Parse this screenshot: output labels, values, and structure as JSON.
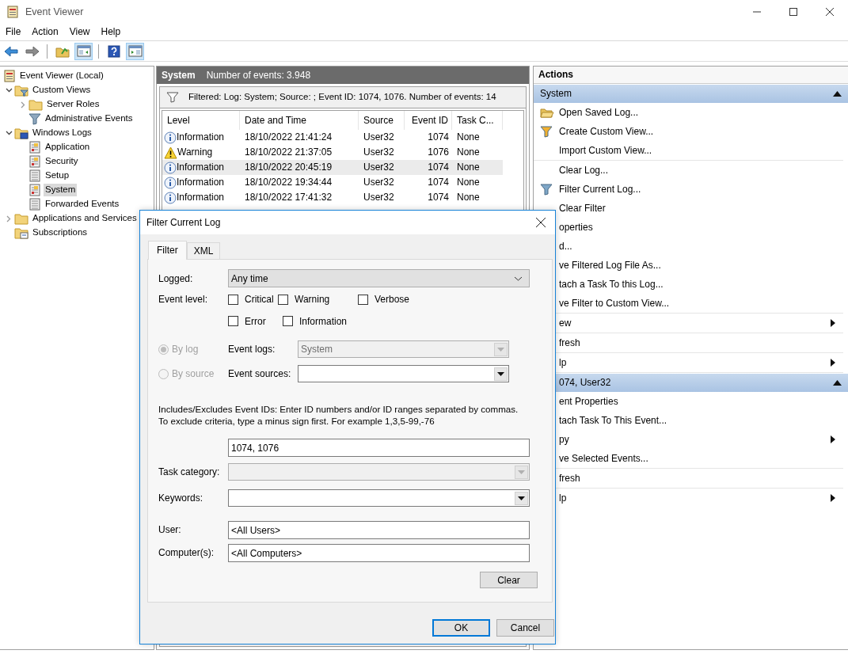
{
  "window": {
    "title": "Event Viewer"
  },
  "menu": [
    "File",
    "Action",
    "View",
    "Help"
  ],
  "toolbar": [
    {
      "kind": "back",
      "pressed": false
    },
    {
      "kind": "forward",
      "pressed": false
    },
    {
      "kind": "sep"
    },
    {
      "kind": "folder-up",
      "pressed": false
    },
    {
      "kind": "pane",
      "pressed": true
    },
    {
      "kind": "sep"
    },
    {
      "kind": "help",
      "pressed": false
    },
    {
      "kind": "pane-right",
      "pressed": true
    }
  ],
  "tree": [
    {
      "label": "Event Viewer (Local)",
      "kind": "root",
      "selected": false,
      "children": [
        {
          "label": "Custom Views",
          "kind": "folder-filter",
          "selected": false,
          "expanded": true,
          "children": [
            {
              "label": "Server Roles",
              "kind": "folder",
              "selected": false,
              "expanded": false
            },
            {
              "label": "Administrative Events",
              "kind": "filter",
              "selected": false
            }
          ]
        },
        {
          "label": "Windows Logs",
          "kind": "folder-logs",
          "selected": false,
          "expanded": true,
          "children": [
            {
              "label": "Application",
              "kind": "log",
              "selected": false
            },
            {
              "label": "Security",
              "kind": "log",
              "selected": false
            },
            {
              "label": "Setup",
              "kind": "log-plain",
              "selected": false
            },
            {
              "label": "System",
              "kind": "log",
              "selected": true
            },
            {
              "label": "Forwarded Events",
              "kind": "log-plain",
              "selected": false
            }
          ]
        },
        {
          "label": "Applications and Services",
          "kind": "folder",
          "selected": false,
          "expanded": false
        },
        {
          "label": "Subscriptions",
          "kind": "folder-sub",
          "selected": false
        }
      ]
    }
  ],
  "log_header": {
    "title": "System",
    "count": "Number of events: 3.948"
  },
  "filter_bar": "Filtered: Log: System; Source: ; Event ID: 1074, 1076. Number of events: 14",
  "table": {
    "columns": [
      "Level",
      "Date and Time",
      "Source",
      "Event ID",
      "Task C..."
    ],
    "rows": [
      {
        "kind": "information",
        "level": "Information",
        "date_time": "18/10/2022 21:41:24",
        "source": "User32",
        "event_id": "1074",
        "task_category": "None",
        "selected": false
      },
      {
        "kind": "warning",
        "level": "Warning",
        "date_time": "18/10/2022 21:37:05",
        "source": "User32",
        "event_id": "1076",
        "task_category": "None",
        "selected": false
      },
      {
        "kind": "information",
        "level": "Information",
        "date_time": "18/10/2022 20:45:19",
        "source": "User32",
        "event_id": "1074",
        "task_category": "None",
        "selected": true
      },
      {
        "kind": "information",
        "level": "Information",
        "date_time": "18/10/2022 19:34:44",
        "source": "User32",
        "event_id": "1074",
        "task_category": "None",
        "selected": false
      },
      {
        "kind": "information",
        "level": "Information",
        "date_time": "18/10/2022 17:41:32",
        "source": "User32",
        "event_id": "1074",
        "task_category": "None",
        "selected": false
      }
    ]
  },
  "actions": {
    "title": "Actions",
    "sections": [
      {
        "title": "System",
        "expanded": true,
        "groups": [
          [
            {
              "label": "Open Saved Log...",
              "kind": "open",
              "submenu": false
            },
            {
              "label": "Create Custom View...",
              "kind": "create-view",
              "submenu": false
            },
            {
              "label": "Import Custom View...",
              "submenu": false
            }
          ],
          [
            {
              "label": "Clear Log...",
              "submenu": false
            },
            {
              "label": "Filter Current Log...",
              "kind": "filter",
              "submenu": false
            },
            {
              "label": "Clear Filter",
              "submenu": false
            },
            {
              "label": "operties",
              "submenu": false
            },
            {
              "label": "d...",
              "submenu": false
            },
            {
              "label": "ve Filtered Log File As...",
              "submenu": false
            },
            {
              "label": "tach a Task To this Log...",
              "submenu": false
            },
            {
              "label": "ve Filter to Custom View...",
              "submenu": false
            }
          ],
          [
            {
              "label": "ew",
              "submenu": true
            }
          ],
          [
            {
              "label": "fresh",
              "submenu": false
            }
          ],
          [
            {
              "label": "lp",
              "submenu": true
            }
          ]
        ]
      },
      {
        "title": "074, User32",
        "expanded": true,
        "groups": [
          [
            {
              "label": "ent Properties",
              "submenu": false
            },
            {
              "label": "tach Task To This Event...",
              "submenu": false
            },
            {
              "label": "py",
              "submenu": true
            },
            {
              "label": "ve Selected Events...",
              "submenu": false
            }
          ],
          [
            {
              "label": "fresh",
              "submenu": false
            }
          ],
          [
            {
              "label": "lp",
              "submenu": true
            }
          ]
        ]
      }
    ]
  },
  "dialog": {
    "title": "Filter Current Log",
    "tabs": [
      {
        "label": "Filter",
        "selected": true
      },
      {
        "label": "XML",
        "selected": false
      }
    ],
    "logged": {
      "label": "Logged:",
      "value": "Any time"
    },
    "event_level": {
      "label": "Event level:",
      "options": [
        {
          "label": "Critical",
          "checked": false
        },
        {
          "label": "Warning",
          "checked": false
        },
        {
          "label": "Verbose",
          "checked": false
        },
        {
          "label": "Error",
          "checked": false
        },
        {
          "label": "Information",
          "checked": false
        }
      ]
    },
    "scope": [
      {
        "label": "By log",
        "selected": true,
        "disabled": true,
        "field_label": "Event logs:",
        "value": "System",
        "field_disabled": true
      },
      {
        "label": "By source",
        "selected": false,
        "disabled": true,
        "field_label": "Event sources:",
        "field_disabled": false
      }
    ],
    "ids_help": "Includes/Excludes Event IDs: Enter ID numbers and/or ID ranges separated by commas. To exclude criteria, type a minus sign first. For example 1,3,5-99,-76",
    "event_ids": "1074, 1076",
    "task_category": {
      "label": "Task category:",
      "disabled": true
    },
    "keywords": {
      "label": "Keywords:",
      "disabled": false
    },
    "user": {
      "label": "User:",
      "value": "<All Users>"
    },
    "computers": {
      "label": "Computer(s):",
      "value": "<All Computers>"
    },
    "clear_button": "Clear",
    "buttons": [
      {
        "label": "OK",
        "default": true
      },
      {
        "label": "Cancel",
        "default": false
      }
    ]
  }
}
